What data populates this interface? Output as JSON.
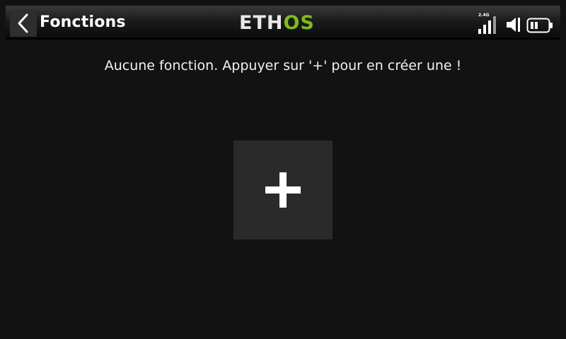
{
  "header": {
    "title": "Fonctions",
    "logo_left": "ETH",
    "logo_right": "OS",
    "logo_accent_color": "#7fbc1a",
    "band_label": "2.4G",
    "back_icon": "chevron-left-icon",
    "signal_icon": "signal-bars-icon",
    "volume_icon": "speaker-icon",
    "battery_icon": "battery-icon"
  },
  "main": {
    "empty_message": "Aucune fonction. Appuyer sur '+' pour en créer une !",
    "add_icon": "plus-icon"
  }
}
